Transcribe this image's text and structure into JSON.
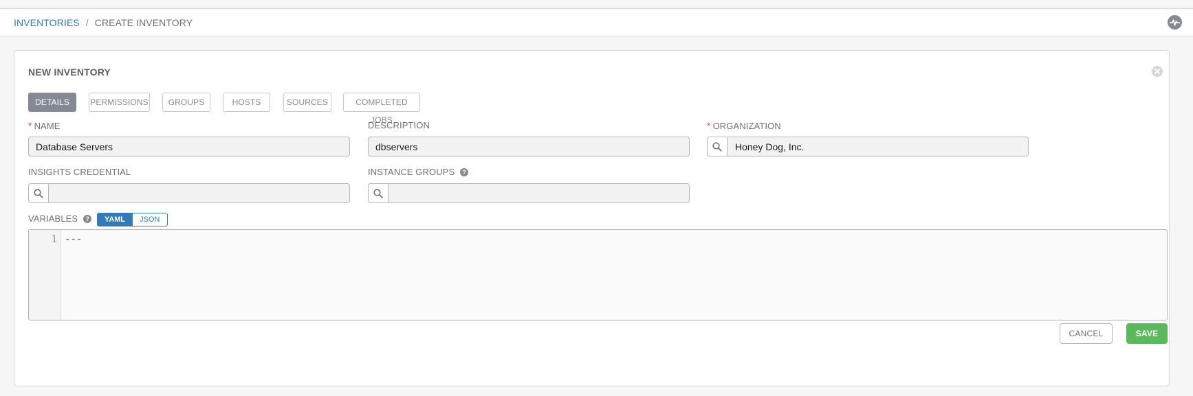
{
  "breadcrumb": {
    "parent": "INVENTORIES",
    "separator": "/",
    "current": "CREATE INVENTORY"
  },
  "header": {
    "activity_icon": "activity-stream-icon"
  },
  "panel": {
    "title": "NEW INVENTORY",
    "close_icon": "close-circle-icon"
  },
  "tabs": [
    {
      "label": "DETAILS",
      "active": true
    },
    {
      "label": "PERMISSIONS",
      "active": false
    },
    {
      "label": "GROUPS",
      "active": false
    },
    {
      "label": "HOSTS",
      "active": false
    },
    {
      "label": "SOURCES",
      "active": false
    },
    {
      "label": "COMPLETED JOBS",
      "active": false
    }
  ],
  "form": {
    "name": {
      "label": "NAME",
      "required_mark": "*",
      "value": "Database Servers"
    },
    "description": {
      "label": "DESCRIPTION",
      "value": "dbservers"
    },
    "organization": {
      "label": "ORGANIZATION",
      "required_mark": "*",
      "value": "Honey Dog, Inc."
    },
    "insights_credential": {
      "label": "INSIGHTS CREDENTIAL",
      "value": ""
    },
    "instance_groups": {
      "label": "INSTANCE GROUPS",
      "help": "?",
      "value": ""
    },
    "variables": {
      "label": "VARIABLES",
      "help": "?",
      "modes": [
        "YAML",
        "JSON"
      ],
      "selected_mode": "YAML",
      "line_number": "1",
      "content": "---"
    }
  },
  "actions": {
    "cancel_label": "CANCEL",
    "save_label": "SAVE"
  },
  "colors": {
    "link": "#337ab7",
    "active_tab": "#848992",
    "required": "#d9534f",
    "save": "#5cb85c",
    "yaml_code": "#2d2cc9"
  }
}
